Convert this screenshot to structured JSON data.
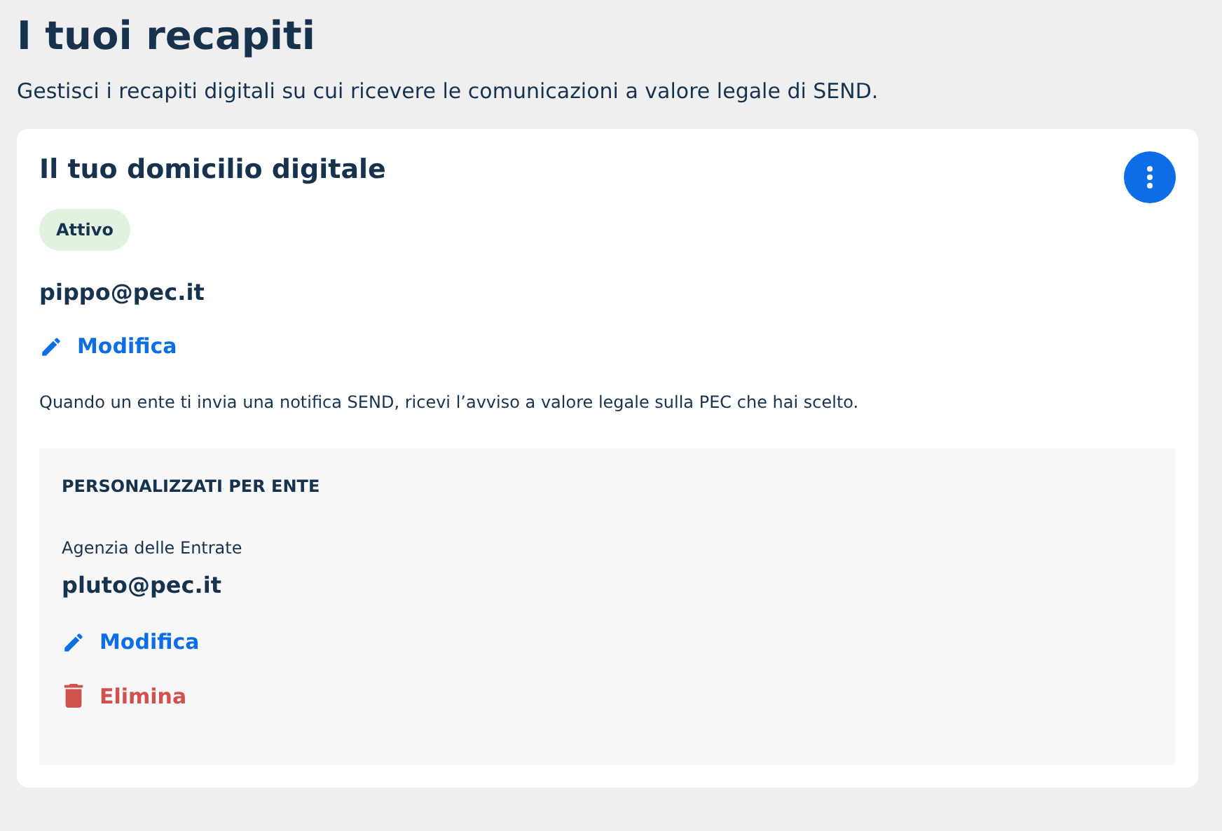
{
  "page": {
    "title": "I tuoi recapiti",
    "subtitle": "Gestisci i recapiti digitali su cui ricevere le comunicazioni a valore legale di SEND."
  },
  "card": {
    "title": "Il tuo domicilio digitale",
    "status": "Attivo",
    "email": "pippo@pec.it",
    "actions": [
      {
        "kind": "edit",
        "label": "Modifica"
      }
    ],
    "description": "Quando un ente ti invia una notifica SEND, ricevi l’avviso a valore legale sulla PEC che hai scelto.",
    "custom": {
      "heading": "PERSONALIZZATI PER ENTE",
      "entity": "Agenzia delle Entrate",
      "email": "pluto@pec.it",
      "actions": [
        {
          "kind": "edit",
          "label": "Modifica"
        },
        {
          "kind": "delete",
          "label": "Elimina"
        }
      ]
    }
  }
}
